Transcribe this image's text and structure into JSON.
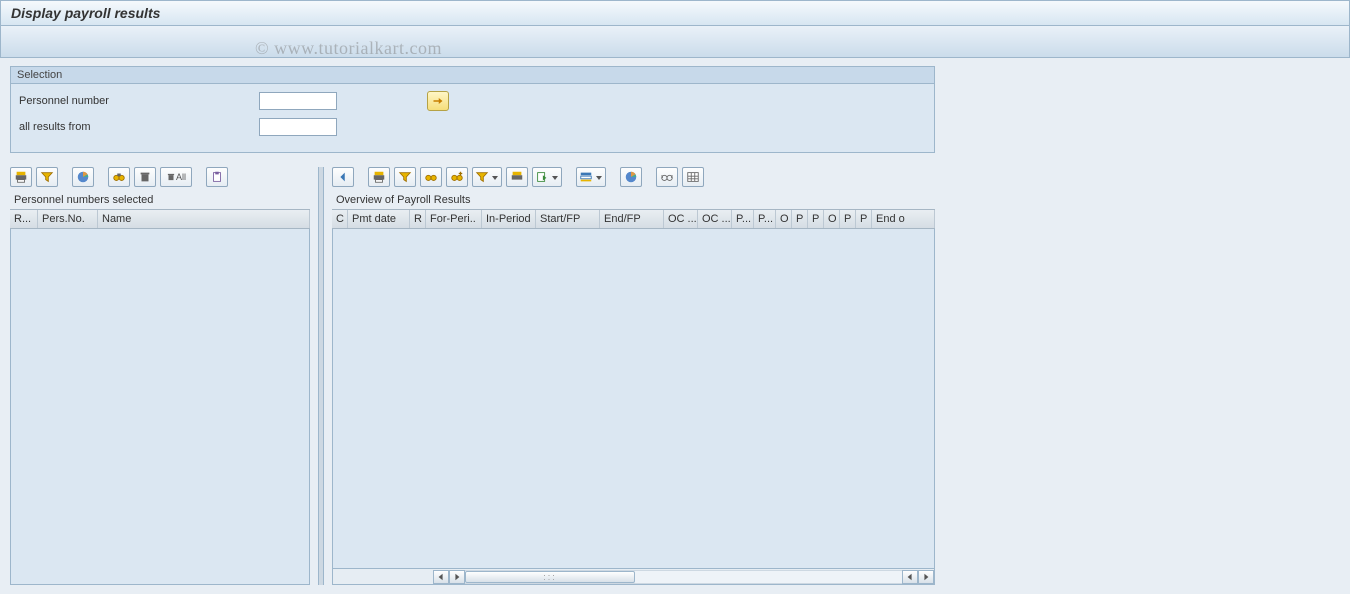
{
  "title": "Display payroll results",
  "watermark": "© www.tutorialkart.com",
  "selection": {
    "header": "Selection",
    "personnel_number_label": "Personnel number",
    "personnel_number_value": "",
    "all_results_from_label": "all results from",
    "all_results_from_value": ""
  },
  "left_panel": {
    "title": "Personnel numbers selected",
    "columns": [
      "R...",
      "Pers.No.",
      "Name"
    ],
    "toolbar_all": "All"
  },
  "right_panel": {
    "title": "Overview of Payroll Results",
    "columns": [
      "C",
      "Pmt date",
      "R",
      "For-Peri..",
      "In-Period",
      "Start/FP",
      "End/FP",
      "OC ...",
      "OC ...",
      "P...",
      "P...",
      "O",
      "P",
      "P",
      "O",
      "P",
      "P",
      "End o"
    ]
  }
}
